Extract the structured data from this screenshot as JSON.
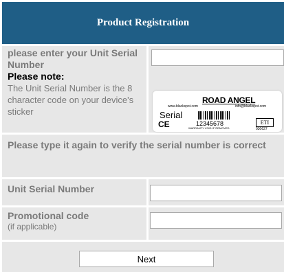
{
  "form": {
    "title": "Product Registration",
    "serial_prompt": "please enter your Unit Serial Number",
    "note_heading": "Please note:",
    "note_text": "The Unit Serial Number is the 8 character code on your device's sticker",
    "verify_prompt": "Please type it again to verify the serial number is correct",
    "unit_serial_label": "Unit Serial Number",
    "promo_label": "Promotional code",
    "promo_hint": "(if applicable)",
    "next_label": "Next",
    "serial_value": "",
    "verify_value": "",
    "promo_value": ""
  },
  "sticker": {
    "brand": "ROAD ANGEL",
    "website": "www.blackspot.com",
    "email": "info@blackspot.com",
    "serial_label": "Serial",
    "ce_mark": "CE",
    "serial_number": "12345678",
    "warranty_text": "WARRANTY VOID IF REMOVED",
    "logo_text": "ETI",
    "code": "030627"
  },
  "colors": {
    "header_bg": "#1f5e86",
    "cell_bg": "#e7e7e7",
    "label_gray": "#7a7a7a"
  }
}
